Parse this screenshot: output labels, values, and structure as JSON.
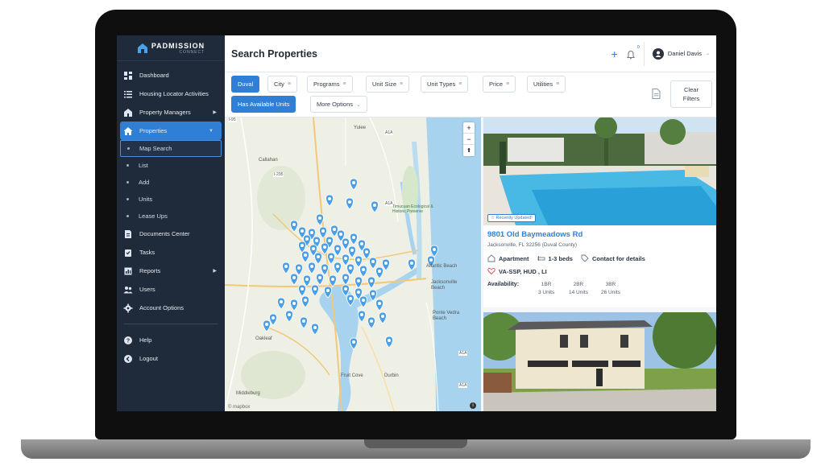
{
  "app": {
    "logo_text": "PADMISSION",
    "logo_sub": "CONNECT"
  },
  "sidebar": {
    "items": [
      {
        "label": "Dashboard",
        "icon": "dashboard-icon"
      },
      {
        "label": "Housing Locator Activities",
        "icon": "list-icon"
      },
      {
        "label": "Property Managers",
        "icon": "building-icon",
        "has_arrow": true
      },
      {
        "label": "Properties",
        "icon": "home-icon",
        "active": true,
        "has_arrow": true
      }
    ],
    "sub_items": [
      {
        "label": "Map Search",
        "active": true
      },
      {
        "label": "List"
      },
      {
        "label": "Add"
      },
      {
        "label": "Units"
      },
      {
        "label": "Lease Ups"
      }
    ],
    "items_after": [
      {
        "label": "Documents Center",
        "icon": "document-icon"
      },
      {
        "label": "Tasks",
        "icon": "tasks-icon"
      },
      {
        "label": "Reports",
        "icon": "reports-icon",
        "has_arrow": true
      },
      {
        "label": "Users",
        "icon": "users-icon"
      },
      {
        "label": "Account Options",
        "icon": "gear-icon"
      }
    ],
    "footer_items": [
      {
        "label": "Help",
        "icon": "help-icon"
      },
      {
        "label": "Logout",
        "icon": "logout-icon"
      }
    ]
  },
  "header": {
    "title": "Search Properties",
    "notification_count": "0",
    "user_name": "Daniel Davis"
  },
  "filters": {
    "chips": [
      "Duval",
      "City",
      "Programs",
      "Unit Size",
      "Unit Types",
      "Price",
      "Utilities"
    ],
    "has_available_units": "Has Available Units",
    "more_options": "More Options",
    "clear_line1": "Clear",
    "clear_line2": "Filters"
  },
  "map": {
    "labels": [
      "Yulee",
      "Callahan",
      "Timucuan Ecological & Historic Preserve",
      "Atlantic Beach",
      "Jacksonville Beach",
      "Ponte Vedra Beach",
      "Oakleaf",
      "Fruit Cove",
      "Durbin",
      "Middleburg"
    ],
    "road_labels": [
      "I-95",
      "A1A",
      "I-295",
      "A1A",
      "A1A",
      "A1A"
    ],
    "attribution": "© mapbox",
    "zoom_in": "+",
    "zoom_out": "−"
  },
  "listings": [
    {
      "badge": "Recently Updated!",
      "title": "9801 Old Baymeadows Rd",
      "address": "Jacksonville, FL 32256 (Duval County)",
      "type": "Apartment",
      "beds": "1-3 beds",
      "contact": "Contact for details",
      "programs": "VA-SSP, HUD , LI",
      "availability_label": "Availability:",
      "availability": [
        {
          "size": "1BR",
          "units": "3 Units"
        },
        {
          "size": "2BR",
          "units": "14 Units"
        },
        {
          "size": "3BR",
          "units": "26 Units"
        }
      ]
    }
  ],
  "colors": {
    "primary": "#2f7fd6",
    "sidebar": "#1f2a3a",
    "pin": "#4a9fe6"
  }
}
